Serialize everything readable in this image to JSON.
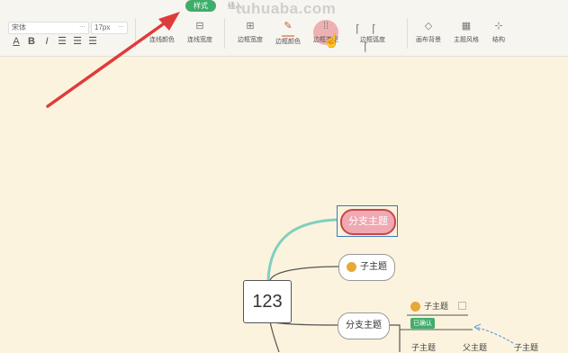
{
  "tabs": {
    "style": "样式",
    "insert": "插入"
  },
  "watermark": "tuhuaba.com",
  "font": {
    "family": "宋体",
    "size": "17px"
  },
  "format": {
    "underline": "A",
    "bold": "B",
    "italic": "I"
  },
  "tools": {
    "line_color": "连线颜色",
    "line_width": "连线宽度",
    "border_width": "边框宽度",
    "border_color": "边框颜色",
    "border_type": "边框类型",
    "border_radius": "边框弧度",
    "canvas_bg": "画布背景",
    "theme_style": "主题风格",
    "structure": "结构"
  },
  "mindmap": {
    "root": "123",
    "branch1": "分支主题",
    "sub1": "子主题",
    "branch2": "分支主题",
    "sub2": "子主题",
    "badge": "已确认",
    "child_a": "子主题",
    "parent": "父主题",
    "child_b": "子主题"
  },
  "colors": {
    "accent": "#3fae6a",
    "canvas": "#fbf3dd",
    "selected_fill": "#f0a9b2",
    "selected_border": "#c9464a",
    "connector": "#7fcfc0",
    "arrow": "#e03b3b"
  }
}
